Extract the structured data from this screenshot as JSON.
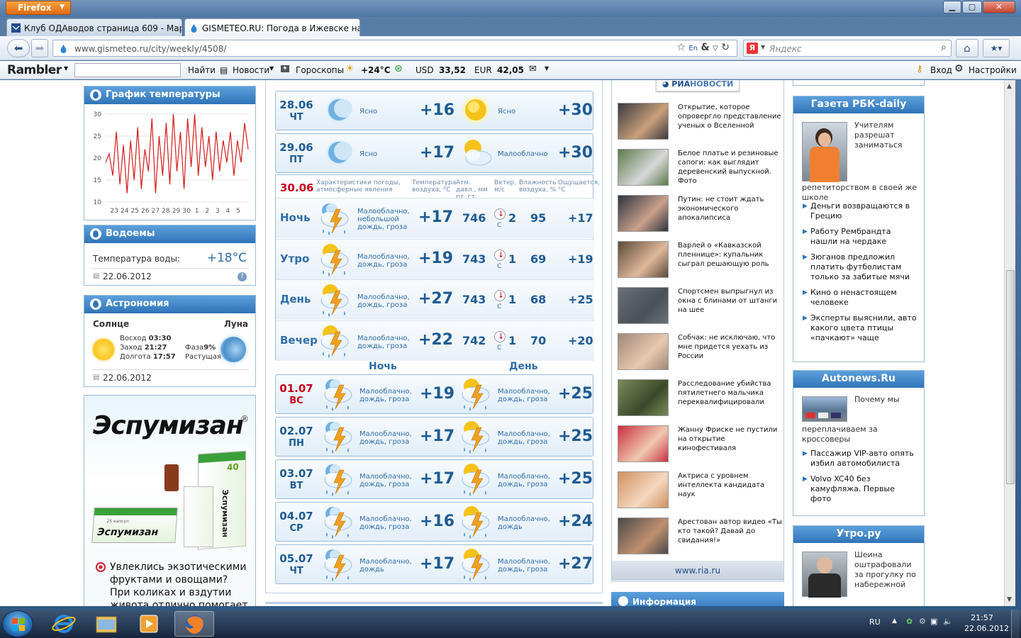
{
  "browser": {
    "app_button": "Firefox",
    "tabs": [
      {
        "label": "Клуб ОДАводов страница 609 - Мар...",
        "active": false
      },
      {
        "label": "GISMETEO.RU: Погода в Ижевске на...",
        "active": true
      }
    ],
    "url": "www.gismeteo.ru/city/weekly/4508/",
    "search_placeholder": "Яндекс",
    "search_engine_letter": "Я"
  },
  "rambler": {
    "logo": "Rambler",
    "find": "Найти",
    "news": "Новости",
    "horoscopes": "Гороскопы",
    "temp": "+24°C",
    "usd_label": "USD",
    "usd_value": "33,52",
    "eur_label": "EUR",
    "eur_value": "42,05",
    "login": "Вход",
    "settings": "Настройки"
  },
  "left": {
    "chart_title": "График температуры",
    "water_title": "Водоемы",
    "water_label": "Температура воды:",
    "water_value": "+18°C",
    "water_date": "22.06.2012",
    "astro_title": "Астрономия",
    "sun": "Солнце",
    "moon": "Луна",
    "sunrise_label": "Восход",
    "sunrise": "03:30",
    "sunset_label": "Заход",
    "sunset": "21:27",
    "daylength_label": "Долгота",
    "daylength": "17:57",
    "phase_label": "Фаза",
    "phase": "9%",
    "phase_state": "Растущая",
    "astro_date": "22.06.2012",
    "ad_brand": "Эспумизан",
    "ad_reg": "®",
    "ad_pack1": "Эспумизан",
    "ad_pack1_small": "25 капсул",
    "ad_pack2": "Эспумизан",
    "ad_bottle": "40",
    "ad_line1": "Увлеклись экзотическими",
    "ad_line2": "фруктами и овощами?",
    "ad_line3": "При коликах и вздутии",
    "ad_line4": "живота отлично помогает"
  },
  "chart_data": {
    "type": "line",
    "x_ticks": [
      "23",
      "24",
      "25",
      "26",
      "27",
      "28",
      "29",
      "30",
      "1",
      "2",
      "3",
      "4",
      "5"
    ],
    "y_ticks": [
      10,
      15,
      20,
      25,
      30
    ],
    "ylim": [
      10,
      30
    ],
    "values": [
      19,
      21,
      16,
      26,
      14,
      23,
      12,
      24,
      15,
      27,
      13,
      22,
      17,
      29,
      12,
      25,
      16,
      28,
      14,
      30,
      17,
      26,
      13,
      29,
      18,
      30,
      16,
      27,
      18,
      25,
      15,
      26,
      17,
      24,
      19,
      26,
      16,
      24,
      19,
      28,
      22
    ]
  },
  "forecast": [
    {
      "date": "28.06",
      "wd": "ЧТ",
      "red": false,
      "night_icon": "moon",
      "night_desc": "Ясно",
      "night_t": "+16",
      "day_icon": "sun",
      "day_desc": "Ясно",
      "day_t": "+30"
    },
    {
      "date": "29.06",
      "wd": "ПТ",
      "red": false,
      "night_icon": "moon",
      "night_desc": "Ясно",
      "night_t": "+17",
      "day_icon": "sun-cloud",
      "day_desc": "Малооблачно",
      "day_t": "+30"
    }
  ],
  "detail": {
    "date": "30.06",
    "h_conditions": "Характеристики погоды, атмосферные явления",
    "h_temp": "Температура воздуха, °C",
    "h_pressure": "Атм. давл., мм рт. ст.",
    "h_wind": "Ветер, м/с",
    "h_humidity": "Влажность воздуха, %",
    "h_feels": "Ощущается, °C",
    "rows": [
      {
        "label": "Ночь",
        "desc1": "Малооблачно,",
        "desc2": "небольшой",
        "desc3": "дождь, гроза",
        "t": "+17",
        "p": "746",
        "dir": "С",
        "w": "2",
        "h": "95",
        "f": "+17"
      },
      {
        "label": "Утро",
        "desc1": "Малооблачно,",
        "desc2": "дождь, гроза",
        "desc3": "",
        "t": "+19",
        "p": "743",
        "dir": "С",
        "w": "1",
        "h": "69",
        "f": "+19"
      },
      {
        "label": "День",
        "desc1": "Малооблачно,",
        "desc2": "дождь, гроза",
        "desc3": "",
        "t": "+27",
        "p": "743",
        "dir": "С",
        "w": "1",
        "h": "68",
        "f": "+25"
      },
      {
        "label": "Вечер",
        "desc1": "Малооблачно,",
        "desc2": "дождь, гроза",
        "desc3": "",
        "t": "+22",
        "p": "742",
        "dir": "С",
        "w": "1",
        "h": "70",
        "f": "+20"
      }
    ]
  },
  "forecast_labels": {
    "night": "Ночь",
    "day": "День"
  },
  "forecast2": [
    {
      "date": "01.07",
      "wd": "ВС",
      "red": true,
      "night_desc1": "Малооблачно,",
      "night_desc2": "дождь, гроза",
      "night_t": "+19",
      "day_desc1": "Малооблачно,",
      "day_desc2": "дождь, гроза",
      "day_t": "+25"
    },
    {
      "date": "02.07",
      "wd": "ПН",
      "red": false,
      "night_desc1": "Малооблачно,",
      "night_desc2": "дождь, гроза",
      "night_t": "+17",
      "day_desc1": "Малооблачно,",
      "day_desc2": "дождь, гроза",
      "day_t": "+25"
    },
    {
      "date": "03.07",
      "wd": "ВТ",
      "red": false,
      "night_desc1": "Малооблачно,",
      "night_desc2": "дождь, гроза",
      "night_t": "+17",
      "day_desc1": "Малооблачно,",
      "day_desc2": "дождь, гроза",
      "day_t": "+25"
    },
    {
      "date": "04.07",
      "wd": "СР",
      "red": false,
      "night_desc1": "Малооблачно,",
      "night_desc2": "дождь, гроза",
      "night_t": "+16",
      "day_desc1": "Малооблачно,",
      "day_desc2": "дождь",
      "day_t": "+24"
    },
    {
      "date": "05.07",
      "wd": "ЧТ",
      "red": false,
      "night_desc1": "Малооблачно,",
      "night_desc2": "дождь",
      "night_t": "+17",
      "day_desc1": "Малооблачно,",
      "day_desc2": "дождь, гроза",
      "day_t": "+27"
    }
  ],
  "ria": {
    "logo_a": "РИА",
    "logo_b": "НОВОСТИ",
    "footer": "www.ria.ru",
    "info": "Информация",
    "items": [
      "Открытие, которое опровергло представление ученых о Вселенной",
      "Белое платье и резиновые сапоги: как выглядит деревенский выпускной. Фото",
      "Путин: не стоит ждать экономического апокалипсиса",
      "Варлей о «Кавказской пленнице»: купальник сыграл решающую роль",
      "Спортсмен выпрыгнул из окна с блинами от штанги на шее",
      "Собчак: не исключаю, что мне придется уехать из России",
      "Расследование убийства пятилетнего мальчика переквалифицировали",
      "Жанну Фриске не пустили на открытие кинофестиваля",
      "Актриса с уровнем интеллекта кандидата наук",
      "Арестован автор видео «Ты кто такой? Давай до свидания!»"
    ]
  },
  "rbc": {
    "title": "Газета РБК-daily",
    "lead1": "Учителям разрешат заниматься",
    "lead2": "репетиторством в своей же школе",
    "links": [
      "Деньги возвращаются в Грецию",
      "Работу Рембрандта нашли на чердаке",
      "Зюганов предложил платить футболистам только за забитые мячи",
      "Кино о ненастоящем человеке",
      "Эксперты выяснили, авто какого цвета птицы «пачкают» чаще"
    ]
  },
  "autonews": {
    "title": "Autonews.Ru",
    "lead1": "Почему мы",
    "lead2": "переплачиваем за кроссоверы",
    "links": [
      "Пассажир VIP-авто опять избил автомобилиста",
      "Volvo XC40 без камуфляжа. Первые фото"
    ]
  },
  "utro": {
    "title": "Утро.ру",
    "lead": "Шеина оштрафовали за прогулку по набережной"
  },
  "taskbar": {
    "lang": "RU",
    "time": "21:57",
    "date": "22.06.2012"
  },
  "colors": {
    "accent": "#2f74b8",
    "temp": "#1e5b94",
    "red_date": "#c8001e"
  }
}
